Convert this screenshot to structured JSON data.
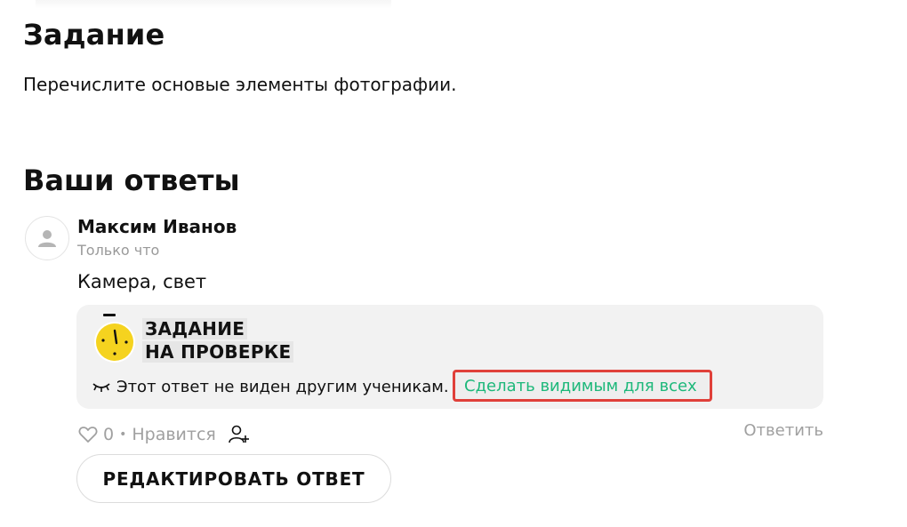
{
  "task": {
    "title": "Задание",
    "text": "Перечислите основые элементы фотографии."
  },
  "answers": {
    "title": "Ваши ответы",
    "item": {
      "author": "Максим Иванов",
      "time": "Только что",
      "text": "Камера, свет",
      "review": {
        "line1": "ЗАДАНИЕ",
        "line2": "НА ПРОВЕРКЕ",
        "hidden_text": "Этот ответ не виден другим ученикам.",
        "make_visible": "Сделать видимым для всех"
      },
      "likes": {
        "count": "0",
        "label": "Нравится"
      },
      "reply": "Ответить",
      "edit_button": "РЕДАКТИРОВАТЬ ОТВЕТ"
    }
  },
  "colors": {
    "accent_green": "#1db87a",
    "highlight_red": "#e0403a",
    "timer_yellow": "#f5d31f"
  },
  "icons": [
    "user-avatar-icon",
    "timer-icon",
    "closed-eye-icon",
    "heart-icon",
    "add-user-icon"
  ]
}
